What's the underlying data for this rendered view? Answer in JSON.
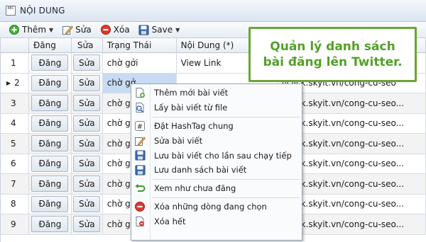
{
  "window": {
    "title": "NỘI DUNG",
    "title_icon": "ABC"
  },
  "toolbar": {
    "add_label": "Thêm",
    "edit_label": "Sửa",
    "delete_label": "Xóa",
    "save_label": "Save"
  },
  "grid": {
    "headers": {
      "dang": "Đăng",
      "sua": "Sửa",
      "trang_thai": "Trạng Thái",
      "noi_dung": "Nội Dung (*)"
    },
    "rows": [
      {
        "num": "1",
        "dang": "Đăng",
        "sua": "Sửa",
        "status": "chờ gởi",
        "content": "View Link",
        "url": ""
      },
      {
        "num": "2",
        "dang": "Đăng",
        "sua": "Sửa",
        "status": "chờ gở",
        "content": "",
        "url": "/iclick.skyit.vn/cong-cu-seo"
      },
      {
        "num": "3",
        "dang": "Đăng",
        "sua": "Sửa",
        "status": "chờ gở",
        "content": "",
        "url": "/iclick.skyit.vn/cong-cu-seo..."
      },
      {
        "num": "4",
        "dang": "Đăng",
        "sua": "Sửa",
        "status": "chờ gở",
        "content": "",
        "url": "/iclick.skyit.vn/cong-cu-seo..."
      },
      {
        "num": "5",
        "dang": "Đăng",
        "sua": "Sửa",
        "status": "chờ gở",
        "content": "",
        "url": "/iclick.skyit.vn/cong-cu-seo..."
      },
      {
        "num": "6",
        "dang": "Đăng",
        "sua": "Sửa",
        "status": "chờ gở",
        "content": "",
        "url": "/iclick.skyit.vn/cong-cu-seo..."
      },
      {
        "num": "7",
        "dang": "Đăng",
        "sua": "Sửa",
        "status": "chờ gở",
        "content": "",
        "url": "/iclick.skyit.vn/cong-cu-seo..."
      },
      {
        "num": "8",
        "dang": "Đăng",
        "sua": "Sửa",
        "status": "chờ gở",
        "content": "",
        "url": "/iclick.skyit.vn/cong-cu-seo..."
      },
      {
        "num": "9",
        "dang": "Đăng",
        "sua": "Sửa",
        "status": "chờ gở",
        "content": "",
        "url": "/iclick.skyit.vn/cong-cu-seo..."
      }
    ]
  },
  "callout": {
    "line1": "Quản lý danh sách",
    "line2": "bài đăng lên Twitter."
  },
  "context_menu": {
    "items": [
      "Thêm mới bài viết",
      "Lấy bài viết từ file",
      "Đặt HashTag chung",
      "Sửa bài viết",
      "Lưu bài viết cho lần sau chạy tiếp",
      "Lưu danh sách bài viết",
      "Xem như chưa đăng",
      "Xóa những dòng đang chọn",
      "Xóa hết"
    ]
  },
  "colors": {
    "callout_green": "#53a02a",
    "callout_border": "#6aa535",
    "delete_red": "#d93a2b"
  }
}
